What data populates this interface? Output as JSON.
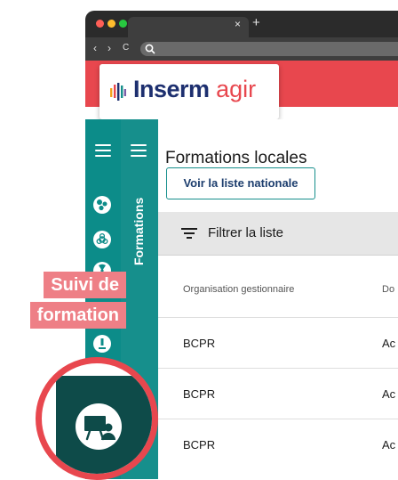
{
  "browser": {
    "tab_close": "×",
    "new_tab": "+",
    "nav_back": "‹",
    "nav_forward": "›",
    "reload": "C"
  },
  "app": {
    "brand_part1": "Inserm",
    "brand_part2": "agir"
  },
  "sidebar": {
    "vertical_label": "Formations",
    "icons": [
      "biology-icon",
      "biohazard-icon",
      "radiation-icon",
      "microscope-icon",
      "flask-icon"
    ]
  },
  "page": {
    "title": "Formations locales",
    "national_button": "Voir la liste nationale",
    "filter_label": "Filtrer la liste"
  },
  "table": {
    "columns": [
      "Organisation gestionnaire",
      "Do"
    ],
    "rows": [
      [
        "BCPR",
        "Ac"
      ],
      [
        "BCPR",
        "Ac"
      ],
      [
        "BCPR",
        "Ac"
      ]
    ]
  },
  "callout": {
    "line1": "Suivi de",
    "line2": "formation"
  },
  "colors": {
    "brand_red": "#e8474e",
    "teal": "#168f8c",
    "dark_teal": "#0e4b49",
    "callout_pink": "#ee7f86",
    "navy": "#1d2f6f"
  }
}
